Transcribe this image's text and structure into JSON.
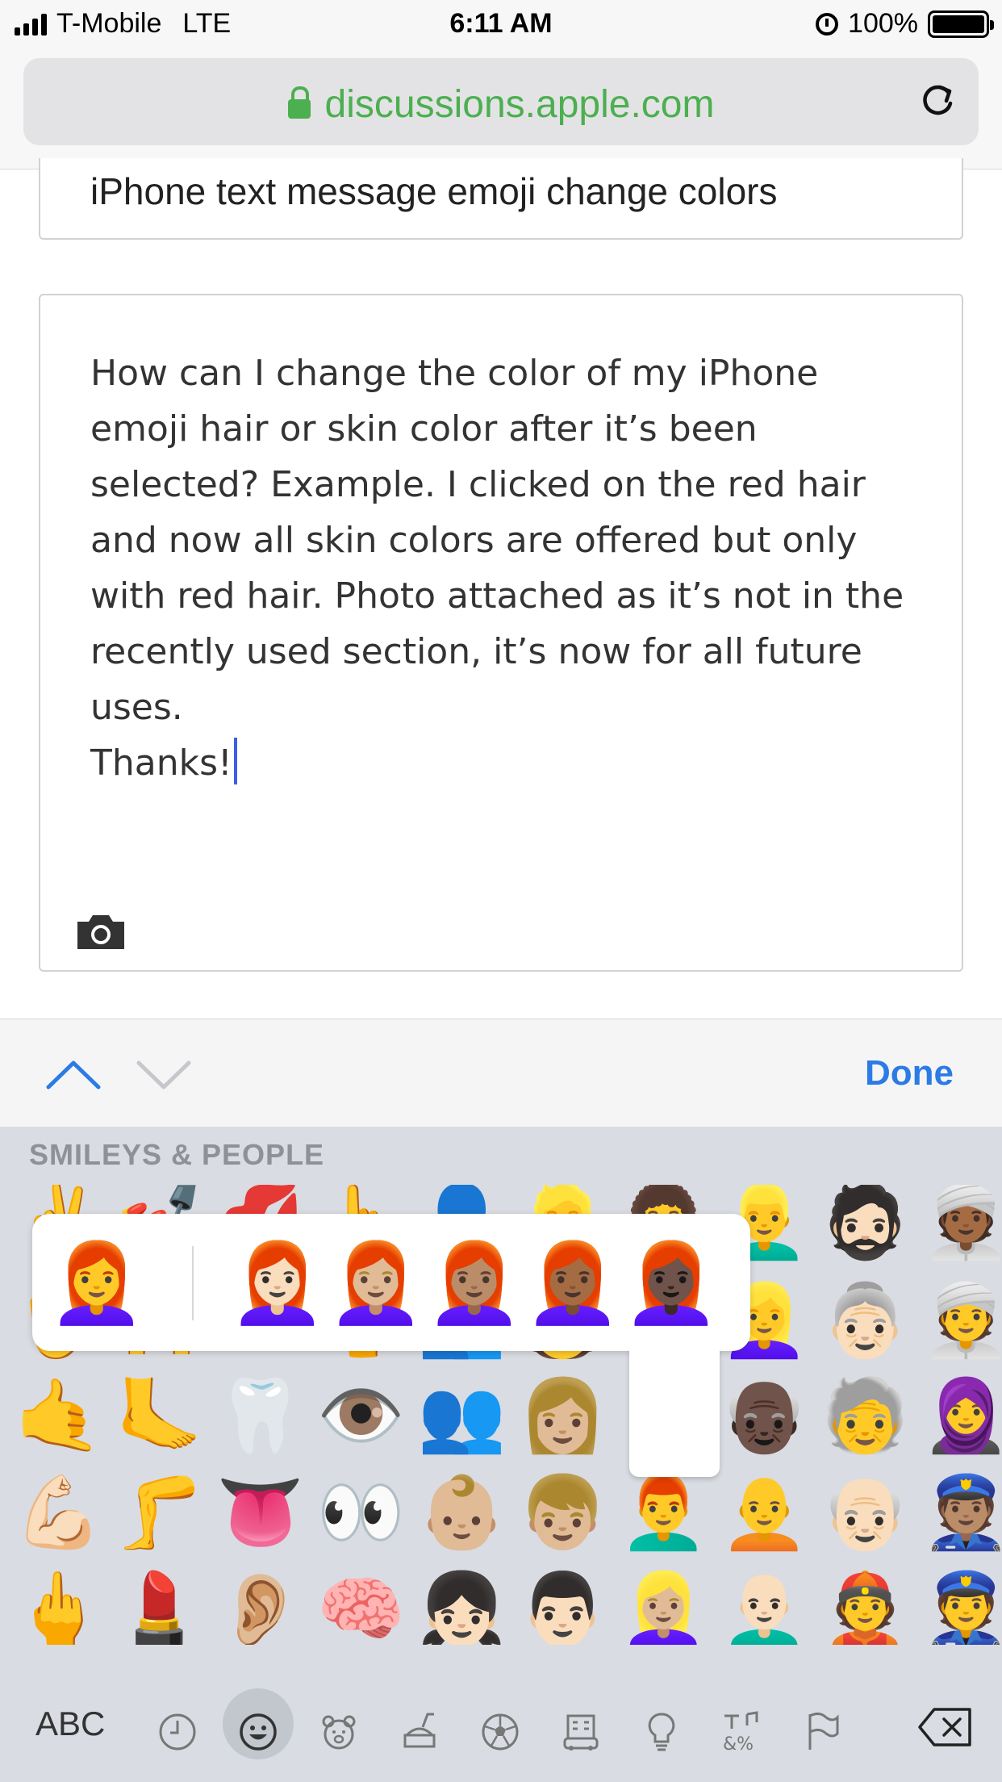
{
  "status_bar": {
    "carrier": "T-Mobile",
    "network": "LTE",
    "time": "6:11 AM",
    "battery": "100%",
    "battery_level": 1.0
  },
  "browser": {
    "url": "discussions.apple.com"
  },
  "form": {
    "subject": "iPhone text message emoji change colors",
    "body": "How can I change the color of my iPhone\nemoji hair or skin color after it’s been\nselected? Example. I clicked on the red hair\nand now all skin colors are offered but only\nwith red hair. Photo attached as it’s not in the\nrecently used section, it’s now for all future\nuses.\nThanks!"
  },
  "accessory_bar": {
    "done_label": "Done"
  },
  "keyboard": {
    "category_title": "SMILEYS & PEOPLE",
    "emoji_rows": [
      [
        "✌️",
        "💅",
        "💋",
        "👆",
        "👤",
        "👱",
        "👩‍🦱",
        "👱‍♂️",
        "🧔🏻",
        "👳🏾"
      ],
      [
        "🖖",
        "🙌",
        "🫦",
        "🖕",
        "👥",
        "🧑",
        "👵",
        "👱‍♀️",
        "👵🏻",
        "👳"
      ],
      [
        "🤙",
        "🦶",
        "🦷",
        "👁️",
        "👥",
        "👩🏼",
        "",
        "👴🏿",
        "🧓",
        "🧕"
      ],
      [
        "💪🏻",
        "🦵",
        "👅",
        "👀",
        "👶🏼",
        "👦🏼",
        "👨‍🦰",
        "🧑‍🦲",
        "👴🏻",
        "👮🏽"
      ],
      [
        "🖕",
        "💄",
        "👂🏼",
        "🧠",
        "👧🏻",
        "👨🏻",
        "👱🏼‍♀️",
        "👨🏻‍🦲",
        "👲",
        "👮"
      ]
    ],
    "popup_variants": [
      "👩‍🦰",
      "👩🏻‍🦰",
      "👩🏼‍🦰",
      "👩🏽‍🦰",
      "👩🏾‍🦰",
      "👩🏿‍🦰"
    ],
    "abc_label": "ABC",
    "category_icons": [
      "clock-icon",
      "smiley-icon",
      "bear-icon",
      "food-icon",
      "ball-icon",
      "building-icon",
      "lightbulb-icon",
      "symbols-icon",
      "flag-icon"
    ]
  }
}
